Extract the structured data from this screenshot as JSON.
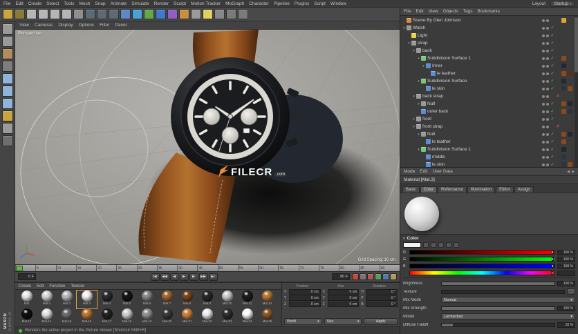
{
  "colors": {
    "accent": "#e8a33d",
    "axis_green": "#4ecb4e"
  },
  "menubar": {
    "items": [
      "File",
      "Edit",
      "Create",
      "Select",
      "Tools",
      "Mesh",
      "Snap",
      "Animate",
      "Simulate",
      "Render",
      "Sculpt",
      "Motion Tracker",
      "MoGraph",
      "Character",
      "Pipeline",
      "Plugins",
      "Script",
      "Window"
    ],
    "layout_label": "Layout",
    "startup_label": "Startup"
  },
  "toolbar": {
    "icons": [
      {
        "name": "undo-icon",
        "bg": "#caa53d"
      },
      {
        "name": "redo-icon",
        "bg": "#8a7a3a"
      },
      {
        "name": "live-selection-icon",
        "bg": "#b5b5b5"
      },
      {
        "name": "move-icon",
        "bg": "#b5b5b5"
      },
      {
        "name": "scale-icon",
        "bg": "#b5b5b5"
      },
      {
        "name": "rotate-icon",
        "bg": "#b5b5b5"
      },
      {
        "name": "last-tool-icon",
        "bg": "#8f8f8f"
      },
      {
        "name": "render-view-icon",
        "bg": "#5d6a75"
      },
      {
        "name": "render-picture-viewer-icon",
        "bg": "#5d6a75"
      },
      {
        "name": "render-settings-icon",
        "bg": "#5d6a75"
      },
      {
        "name": "add-cube-icon",
        "bg": "#5f87c7"
      },
      {
        "name": "add-spline-icon",
        "bg": "#4aa0d8"
      },
      {
        "name": "add-subdivision-surface-icon",
        "bg": "#62a84f"
      },
      {
        "name": "add-mograph-icon",
        "bg": "#3f79c9"
      },
      {
        "name": "add-deformer-icon",
        "bg": "#8d5fc7"
      },
      {
        "name": "add-environment-icon",
        "bg": "#c78f3f"
      },
      {
        "name": "add-camera-icon",
        "bg": "#9a9a9a"
      },
      {
        "name": "add-light-icon",
        "bg": "#e3d060"
      },
      {
        "name": "add-material-icon",
        "bg": "#888888"
      },
      {
        "name": "workplane-icon",
        "bg": "#7a7a7a"
      },
      {
        "name": "snap-icon",
        "bg": "#7a7a7a"
      }
    ]
  },
  "left_toolbar": {
    "icons": [
      {
        "name": "make-editable-icon",
        "bg": "#9a9a9a"
      },
      {
        "name": "model-mode-icon",
        "bg": "#9a9a9a"
      },
      {
        "name": "texture-mode-icon",
        "bg": "#b08d5a"
      },
      {
        "name": "workplane-mode-icon",
        "bg": "#7d7d7d"
      },
      {
        "name": "points-mode-icon",
        "bg": "#8fb3d9"
      },
      {
        "name": "edges-mode-icon",
        "bg": "#8fb3d9"
      },
      {
        "name": "polygons-mode-icon",
        "bg": "#8fb3d9"
      },
      {
        "name": "enable-axis-icon",
        "bg": "#c9a43f"
      },
      {
        "name": "viewport-snap-icon",
        "bg": "#9a9a9a"
      },
      {
        "name": "lock-workplane-icon",
        "bg": "#6e6e6e"
      }
    ]
  },
  "viewport": {
    "menus": [
      "View",
      "Cameras",
      "Display",
      "Options",
      "Filter",
      "Panel"
    ],
    "view_label": "Perspective",
    "grid_label": "Grid Spacing: 10 cm",
    "watermark": {
      "brand": "FILECR",
      "suffix": ".com"
    }
  },
  "timeline": {
    "ticks": [
      "0",
      "5",
      "10",
      "15",
      "20",
      "25",
      "30",
      "35",
      "40",
      "45",
      "50",
      "55",
      "60",
      "65",
      "70",
      "75",
      "80",
      "85",
      "90"
    ],
    "start": "0 F",
    "end": "90 F",
    "glyphs": {
      "gs": "|◀",
      "pk": "◀◀",
      "pf": "◀",
      "play": "▶",
      "nf": "▶",
      "nk": "▶▶",
      "ge": "▶|"
    },
    "keys": [
      {
        "name": "record-keyframe-icon",
        "bg": "#c04a3a"
      },
      {
        "name": "autokey-icon",
        "bg": "#777777"
      },
      {
        "name": "key-position-icon",
        "bg": "#b05555"
      },
      {
        "name": "key-scale-icon",
        "bg": "#55a055"
      },
      {
        "name": "key-rotation-icon",
        "bg": "#5577b0"
      },
      {
        "name": "key-parameter-icon",
        "bg": "#b09a55"
      }
    ]
  },
  "materials": {
    "menus": [
      "Create",
      "Edit",
      "Function",
      "Texture"
    ],
    "items": [
      {
        "name": "Mat",
        "color": "#ececec"
      },
      {
        "name": "Mat.1",
        "color": "#d9d9d9"
      },
      {
        "name": "Mat.2",
        "color": "#bdbdbd"
      },
      {
        "name": "Mat.3",
        "color": "#f4f4f4",
        "sel": "1px solid #e8a33d"
      },
      {
        "name": "Mat.4",
        "color": "#2e2e2e"
      },
      {
        "name": "Mat.5",
        "color": "#161616"
      },
      {
        "name": "Mat.6",
        "color": "#8a8a8a"
      },
      {
        "name": "Mat.7",
        "color": "#a56a32"
      },
      {
        "name": "Mat.8",
        "color": "#7a4a20"
      },
      {
        "name": "Mat.9",
        "color": "#2a2a2a"
      },
      {
        "name": "Mat.10",
        "color": "#cfcfcf"
      },
      {
        "name": "Mat.11",
        "color": "#1e1e1e"
      },
      {
        "name": "Mat.12",
        "color": "#b87a3a"
      },
      {
        "name": "Mat.13",
        "color": "#101010"
      },
      {
        "name": "Mat.14",
        "color": "#e6e6e6"
      },
      {
        "name": "Mat.15",
        "color": "#6e6e6e"
      },
      {
        "name": "Mat.16",
        "color": "#c27a35"
      },
      {
        "name": "Mat.17",
        "color": "#242424"
      },
      {
        "name": "Mat.18",
        "color": "#d4d4d4"
      },
      {
        "name": "Mat.19",
        "color": "#959595"
      },
      {
        "name": "Mat.20",
        "color": "#3c3c3c"
      },
      {
        "name": "Mat.21",
        "color": "#cd853f"
      },
      {
        "name": "Mat.22",
        "color": "#efefef"
      },
      {
        "name": "Mat.23",
        "color": "#2f2f2f"
      },
      {
        "name": "Mat.24",
        "color": "#ffffff"
      },
      {
        "name": "Mat.25",
        "color": "#8a5a2a"
      }
    ]
  },
  "coordinates": {
    "position": {
      "title": "Position",
      "rows": [
        {
          "axis": "X",
          "value": "0 cm"
        },
        {
          "axis": "Y",
          "value": "0 cm"
        },
        {
          "axis": "Z",
          "value": "0 cm"
        }
      ]
    },
    "size": {
      "title": "Size",
      "rows": [
        {
          "axis": "X",
          "value": "0 cm"
        },
        {
          "axis": "Y",
          "value": "0 cm"
        },
        {
          "axis": "Z",
          "value": "0 cm"
        }
      ]
    },
    "rotation": {
      "title": "Rotation",
      "rows": [
        {
          "axis": "H",
          "value": "0 °"
        },
        {
          "axis": "P",
          "value": "0 °"
        },
        {
          "axis": "B",
          "value": "0 °"
        }
      ]
    },
    "world": "World",
    "size_mode": "Size",
    "apply": "Apply"
  },
  "object_manager": {
    "menus": [
      "File",
      "Edit",
      "View",
      "Objects",
      "Tags",
      "Bookmarks"
    ],
    "rows": [
      {
        "label": "Scene By Glen Johnson",
        "ind": "2px",
        "exp": "",
        "icon": "#d98c3a",
        "g": "",
        "r": "",
        "c1": "#e0a33a"
      },
      {
        "label": "Watch",
        "ind": "2px",
        "exp": "▾",
        "icon": "#9a9a9a",
        "g": "✓"
      },
      {
        "label": "Light",
        "ind": "9px",
        "exp": "",
        "icon": "#e8d44a",
        "g": "✓"
      },
      {
        "label": "strap",
        "ind": "9px",
        "exp": "▾",
        "icon": "#9a9a9a",
        "g": "✓"
      },
      {
        "label": "back",
        "ind": "16px",
        "exp": "▾",
        "icon": "#9a9a9a",
        "g": "✓"
      },
      {
        "label": "Subdivision Surface 1",
        "ind": "23px",
        "exp": "▾",
        "icon": "#7ac77a",
        "g": "✓",
        "c1": "#8a4a1f"
      },
      {
        "label": "Inner",
        "ind": "30px",
        "exp": "▾",
        "icon": "#5b8dd6",
        "g": "✓",
        "c1": "#222831"
      },
      {
        "label": "le leather",
        "ind": "37px",
        "exp": "",
        "icon": "#5b8dd6",
        "g": "✓",
        "c1": "#8a4a1f",
        "c2": "#5a3114"
      },
      {
        "label": "Subdivision Surface",
        "ind": "23px",
        "exp": "▾",
        "icon": "#7ac77a",
        "g": "✓",
        "c1": "#222831"
      },
      {
        "label": "le skin",
        "ind": "30px",
        "exp": "",
        "icon": "#5b8dd6",
        "g": "✓",
        "c1": "#2a3442",
        "c2": "#8a4a1f"
      },
      {
        "label": "back strap",
        "ind": "16px",
        "exp": "▾",
        "icon": "#9a9a9a",
        "g": "",
        "r": "✗"
      },
      {
        "label": "Null",
        "ind": "23px",
        "exp": "▾",
        "icon": "#9a9a9a",
        "g": "✓",
        "c1": "#8a4a1f",
        "c2": "#222831"
      },
      {
        "label": "outer back",
        "ind": "23px",
        "exp": "",
        "icon": "#5b8dd6",
        "g": "✓",
        "c1": "#8a4a1f",
        "c2": "#2a3442"
      },
      {
        "label": "front",
        "ind": "16px",
        "exp": "▾",
        "icon": "#9a9a9a",
        "g": "✓"
      },
      {
        "label": "front strap",
        "ind": "16px",
        "exp": "▾",
        "icon": "#9a9a9a",
        "g": "",
        "r": "✗"
      },
      {
        "label": "Null",
        "ind": "23px",
        "exp": "▾",
        "icon": "#9a9a9a",
        "g": "✓",
        "c1": "#8a4a1f",
        "c2": "#222831"
      },
      {
        "label": "le leather",
        "ind": "30px",
        "exp": "",
        "icon": "#5b8dd6",
        "g": "✓",
        "c1": "#8a4a1f"
      },
      {
        "label": "Subdivision Surface 1",
        "ind": "23px",
        "exp": "▾",
        "icon": "#7ac77a",
        "g": "✓",
        "c1": "#222831"
      },
      {
        "label": "middls",
        "ind": "30px",
        "exp": "",
        "icon": "#5b8dd6",
        "g": "✓",
        "c1": "#2a3442"
      },
      {
        "label": "le skin",
        "ind": "30px",
        "exp": "",
        "icon": "#5b8dd6",
        "g": "✓",
        "c1": "#2a3442",
        "c2": "#8a4a1f"
      }
    ]
  },
  "attributes": {
    "menus": [
      "Mode",
      "Edit",
      "User Data"
    ],
    "nav": {
      "back": "◀",
      "forward": "▶"
    },
    "title": "Material [Mat.3]",
    "tabs": [
      {
        "label": "Basic"
      },
      {
        "label": "Color",
        "bg": "#606060"
      },
      {
        "label": "Reflectance"
      },
      {
        "label": "Illumination"
      },
      {
        "label": "Editor"
      },
      {
        "label": "Assign"
      }
    ],
    "color": {
      "section": "Color",
      "sliders": {
        "r": {
          "label": "R",
          "value": "100 %"
        },
        "g": {
          "label": "G",
          "value": "100 %"
        },
        "b": {
          "label": "B",
          "value": "100 %"
        }
      },
      "rows": {
        "brightness": {
          "label": "Brightness",
          "value": "100 %"
        },
        "texture": {
          "label": "Texture",
          "button": "..."
        },
        "mix_mode": {
          "label": "Mix Mode",
          "value": "Normal"
        },
        "mix_strength": {
          "label": "Mix Strength",
          "value": "100 %"
        },
        "model": {
          "label": "Model",
          "value": "Lambertian"
        },
        "diffuse_falloff": {
          "label": "Diffuse Falloff",
          "value": "10 %"
        }
      }
    }
  },
  "status": {
    "text": "Renders the active project in the Picture Viewer [Shortcut Shift+R]"
  },
  "branding": {
    "maxon": "MAXON",
    "cinema": "CINEMA 4D"
  }
}
